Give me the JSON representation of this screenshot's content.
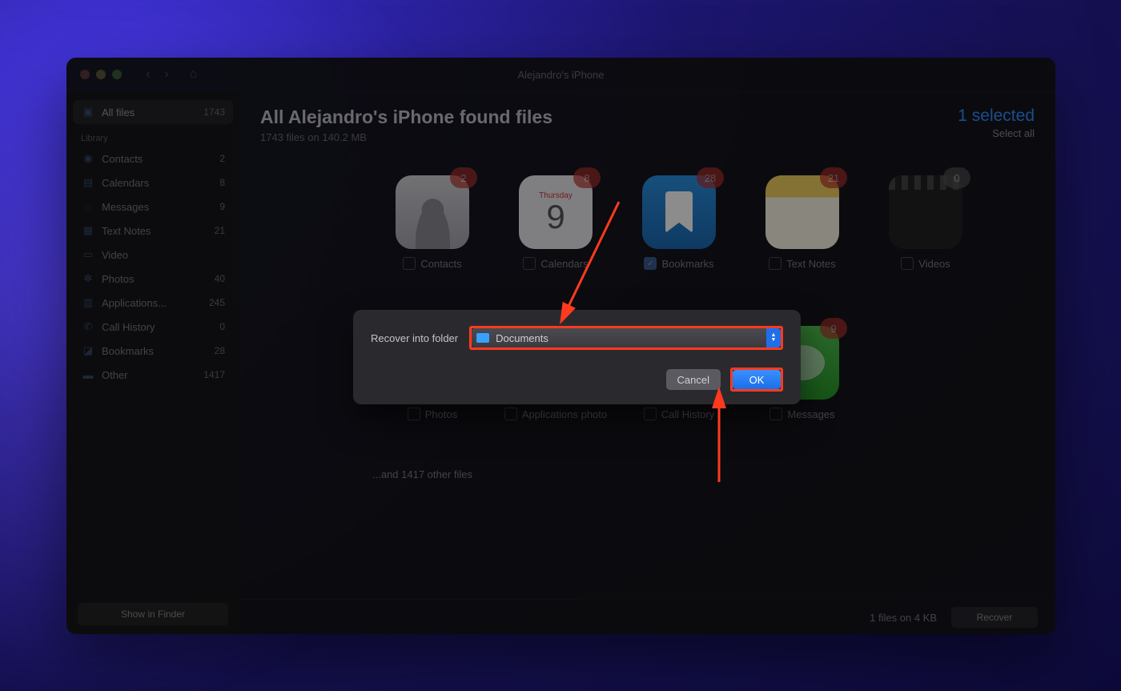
{
  "window_title": "Alejandro's iPhone",
  "sidebar": {
    "all_label": "All files",
    "all_count": "1743",
    "library_label": "Library",
    "items": [
      {
        "label": "Contacts",
        "count": "2"
      },
      {
        "label": "Calendars",
        "count": "8"
      },
      {
        "label": "Messages",
        "count": "9"
      },
      {
        "label": "Text Notes",
        "count": "21"
      },
      {
        "label": "Video",
        "count": ""
      },
      {
        "label": "Photos",
        "count": "40"
      },
      {
        "label": "Applications...",
        "count": "245"
      },
      {
        "label": "Call History",
        "count": "0"
      },
      {
        "label": "Bookmarks",
        "count": "28"
      },
      {
        "label": "Other",
        "count": "1417"
      }
    ],
    "finder_btn": "Show in Finder"
  },
  "header": {
    "title": "All Alejandro's iPhone found files",
    "subtitle": "1743 files on 140.2 MB",
    "selected": "1 selected",
    "select_all": "Select all"
  },
  "tiles": [
    {
      "label": "Contacts",
      "badge": "2",
      "checked": false
    },
    {
      "label": "Calendars",
      "badge": "8",
      "checked": false,
      "day": "Thursday",
      "num": "9"
    },
    {
      "label": "Bookmarks",
      "badge": "28",
      "checked": true
    },
    {
      "label": "Text Notes",
      "badge": "21",
      "checked": false
    },
    {
      "label": "Videos",
      "badge": "0",
      "checked": false
    },
    {
      "label": "Photos",
      "badge": "",
      "checked": false
    },
    {
      "label": "Applications photo",
      "badge": "",
      "checked": false
    },
    {
      "label": "Call History",
      "badge": "",
      "checked": false
    },
    {
      "label": "Messages",
      "badge": "9",
      "checked": false
    }
  ],
  "other_files": "...and 1417 other files",
  "footer": {
    "stat": "1 files on 4 KB",
    "recover": "Recover"
  },
  "dialog": {
    "label": "Recover into folder",
    "folder": "Documents",
    "cancel": "Cancel",
    "ok": "OK"
  }
}
